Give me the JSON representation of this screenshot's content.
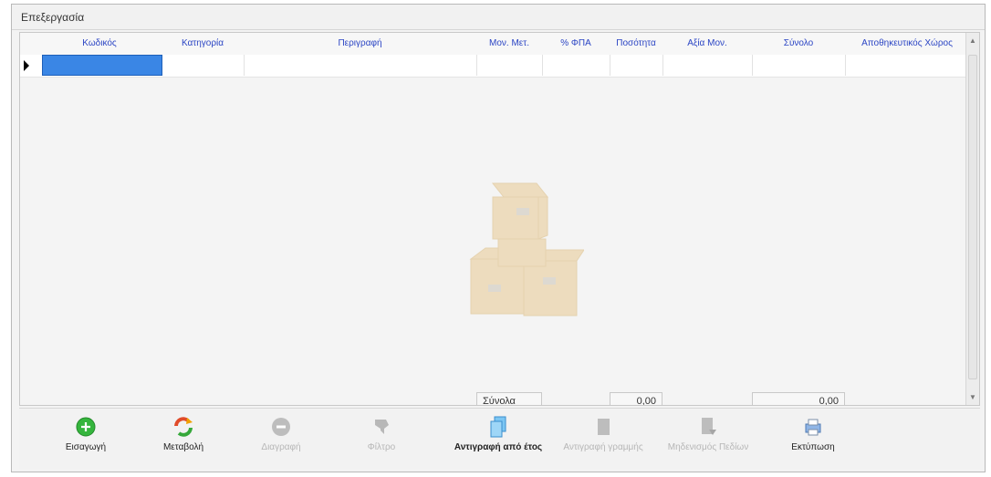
{
  "panel": {
    "title": "Επεξεργασία"
  },
  "grid": {
    "columns": [
      "Κωδικός",
      "Κατηγορία",
      "Περιγραφή",
      "Μον. Μετ.",
      "% ΦΠΑ",
      "Ποσότητα",
      "Αξία Μον.",
      "Σύνολο",
      "Αποθηκευτικός Χώρος"
    ],
    "totals_label": "Σύνολα",
    "total_quantity": "0,00",
    "total_sum": "0,00"
  },
  "toolbar": {
    "buttons": [
      {
        "label": "Εισαγωγή",
        "icon": "plus-circle-icon",
        "enabled": true
      },
      {
        "label": "Μεταβολή",
        "icon": "refresh-icon",
        "enabled": true
      },
      {
        "label": "Διαγραφή",
        "icon": "minus-circle-icon",
        "enabled": false
      },
      {
        "label": "Φίλτρο",
        "icon": "filter-icon",
        "enabled": false
      },
      {
        "label": "Αντιγραφή από έτος",
        "icon": "copy-docs-icon",
        "enabled": true
      },
      {
        "label": "Αντιγραφή γραμμής",
        "icon": "copy-row-icon",
        "enabled": false
      },
      {
        "label": "Μηδενισμός Πεδίων",
        "icon": "reset-fields-icon",
        "enabled": false
      },
      {
        "label": "Εκτύπωση",
        "icon": "print-icon",
        "enabled": true
      }
    ]
  },
  "colors": {
    "accent": "#3a86e5",
    "header_text": "#2b45c4"
  }
}
